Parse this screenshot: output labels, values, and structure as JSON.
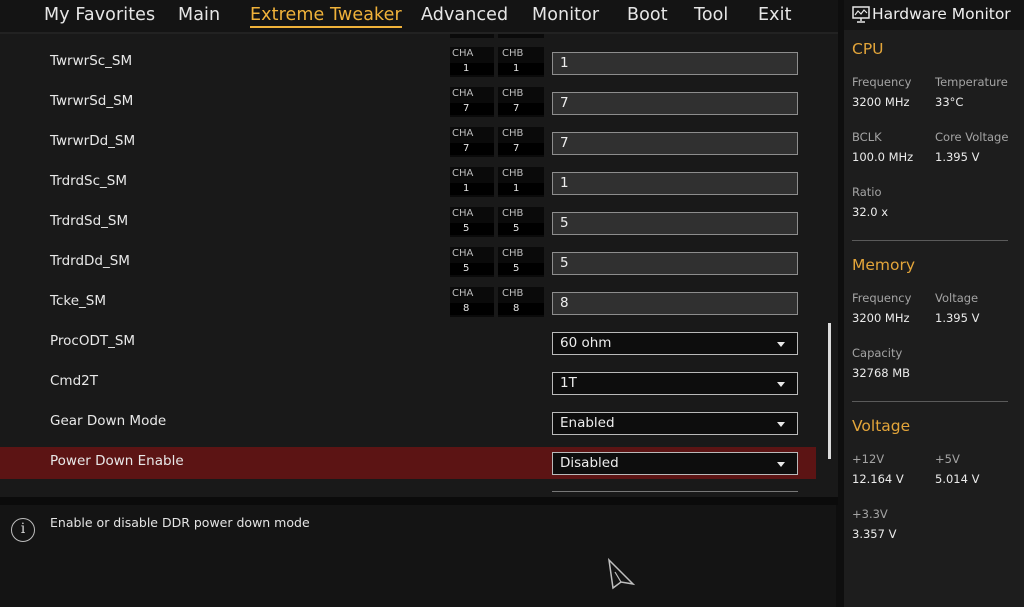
{
  "menu": [
    {
      "label": "My Favorites",
      "active": false
    },
    {
      "label": "Main",
      "active": false
    },
    {
      "label": "Extreme Tweaker",
      "active": true
    },
    {
      "label": "Advanced",
      "active": false
    },
    {
      "label": "Monitor",
      "active": false
    },
    {
      "label": "Boot",
      "active": false
    },
    {
      "label": "Tool",
      "active": false
    },
    {
      "label": "Exit",
      "active": false
    }
  ],
  "settings": [
    {
      "label": "TwrwrSc_SM",
      "cha_label": "CHA",
      "cha": "1",
      "chb_label": "CHB",
      "chb": "1",
      "value": "1",
      "kind": "text"
    },
    {
      "label": "TwrwrSd_SM",
      "cha_label": "CHA",
      "cha": "7",
      "chb_label": "CHB",
      "chb": "7",
      "value": "7",
      "kind": "text"
    },
    {
      "label": "TwrwrDd_SM",
      "cha_label": "CHA",
      "cha": "7",
      "chb_label": "CHB",
      "chb": "7",
      "value": "7",
      "kind": "text"
    },
    {
      "label": "TrdrdSc_SM",
      "cha_label": "CHA",
      "cha": "1",
      "chb_label": "CHB",
      "chb": "1",
      "value": "1",
      "kind": "text"
    },
    {
      "label": "TrdrdSd_SM",
      "cha_label": "CHA",
      "cha": "5",
      "chb_label": "CHB",
      "chb": "5",
      "value": "5",
      "kind": "text"
    },
    {
      "label": "TrdrdDd_SM",
      "cha_label": "CHA",
      "cha": "5",
      "chb_label": "CHB",
      "chb": "5",
      "value": "5",
      "kind": "text"
    },
    {
      "label": "Tcke_SM",
      "cha_label": "CHA",
      "cha": "8",
      "chb_label": "CHB",
      "chb": "8",
      "value": "8",
      "kind": "text"
    },
    {
      "label": "ProcODT_SM",
      "value": "60 ohm",
      "kind": "select"
    },
    {
      "label": "Cmd2T",
      "value": "1T",
      "kind": "select"
    },
    {
      "label": "Gear Down Mode",
      "value": "Enabled",
      "kind": "select"
    },
    {
      "label": "Power Down Enable",
      "value": "Disabled",
      "kind": "select",
      "selected": true
    }
  ],
  "help": {
    "info_glyph": "i",
    "text": "Enable or disable DDR power down mode"
  },
  "hardware_monitor": {
    "title": "Hardware Monitor",
    "cpu": {
      "heading": "CPU",
      "frequency_label": "Frequency",
      "frequency": "3200 MHz",
      "temperature_label": "Temperature",
      "temperature": "33°C",
      "bclk_label": "BCLK",
      "bclk": "100.0 MHz",
      "core_voltage_label": "Core Voltage",
      "core_voltage": "1.395 V",
      "ratio_label": "Ratio",
      "ratio": "32.0 x"
    },
    "memory": {
      "heading": "Memory",
      "frequency_label": "Frequency",
      "frequency": "3200 MHz",
      "voltage_label": "Voltage",
      "voltage": "1.395 V",
      "capacity_label": "Capacity",
      "capacity": "32768 MB"
    },
    "voltage": {
      "heading": "Voltage",
      "v12_label": "+12V",
      "v12": "12.164 V",
      "v5_label": "+5V",
      "v5": "5.014 V",
      "v33_label": "+3.3V",
      "v33": "3.357 V"
    }
  },
  "colors": {
    "accent": "#f0b23a",
    "selected_row": "#5c1414",
    "section_heading": "#e3a53a"
  }
}
